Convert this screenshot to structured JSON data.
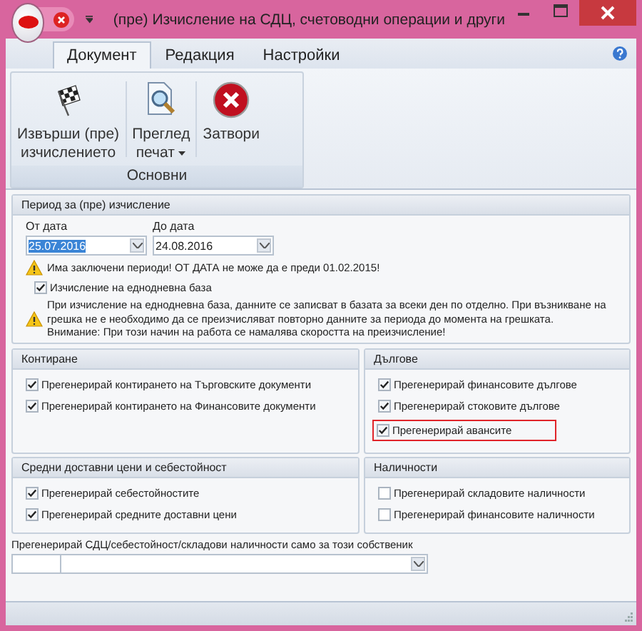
{
  "window": {
    "title": "(пре) Изчисление на СДЦ, счетоводни операции и други"
  },
  "tabs": [
    {
      "label": "Документ",
      "selected": true
    },
    {
      "label": "Редакция",
      "selected": false
    },
    {
      "label": "Настройки",
      "selected": false
    }
  ],
  "ribbon": {
    "group": "Основни",
    "buttons": [
      {
        "kind": "flag",
        "lines": [
          "Извърши (пре)",
          "изчислението"
        ],
        "dropdown": false
      },
      {
        "kind": "preview",
        "lines": [
          "Преглед",
          "печат"
        ],
        "dropdown": true
      },
      {
        "kind": "close",
        "lines": [
          "Затвори"
        ],
        "dropdown": false
      }
    ]
  },
  "period": {
    "title": "Период за (пре) изчисление",
    "from_label": "От дата",
    "from_value": "25.07.2016",
    "to_label": "До дата",
    "to_value": "24.08.2016",
    "warning": "Има заключени периоди! ОТ ДАТА не може да е преди 01.02.2015!",
    "single_day": {
      "label": "Изчисление на еднодневна база",
      "checked": true
    },
    "info_lines": [
      "При изчисление на еднодневна база, данните се записват в базата за всеки ден по отделно. При възникване на",
      "грешка не е необходимо да се преизчисляват повторно данните за периода до момента на грешката.",
      "Внимание: При този начин на работа се намалява скоростта на преизчисление!"
    ]
  },
  "groups": [
    {
      "title": "Контиране",
      "items": [
        {
          "label": "Прегенерирай контирането на Търговските документи",
          "checked": true,
          "highlighted": false
        },
        {
          "label": "Прегенерирай контирането на Финансовите документи",
          "checked": true,
          "highlighted": false
        }
      ]
    },
    {
      "title": "Дългове",
      "items": [
        {
          "label": "Прегенерирай финансовите дългове",
          "checked": true,
          "highlighted": false
        },
        {
          "label": "Прегенерирай стоковите дългове",
          "checked": true,
          "highlighted": false
        },
        {
          "label": "Прегенерирай авансите",
          "checked": true,
          "highlighted": true
        }
      ]
    },
    {
      "title": "Средни доставни цени и себестойност",
      "items": [
        {
          "label": "Прегенерирай себестойностите",
          "checked": true,
          "highlighted": false
        },
        {
          "label": "Прегенерирай средните доставни цени",
          "checked": true,
          "highlighted": false
        }
      ]
    },
    {
      "title": "Наличности",
      "items": [
        {
          "label": "Прегенерирай складовите наличности",
          "checked": false,
          "highlighted": false
        },
        {
          "label": "Прегенерирай финансовите наличности",
          "checked": false,
          "highlighted": false
        }
      ]
    }
  ],
  "owner": {
    "label": "Прегенерирай СДЦ/себестойност/складови наличности само за този собственик"
  }
}
